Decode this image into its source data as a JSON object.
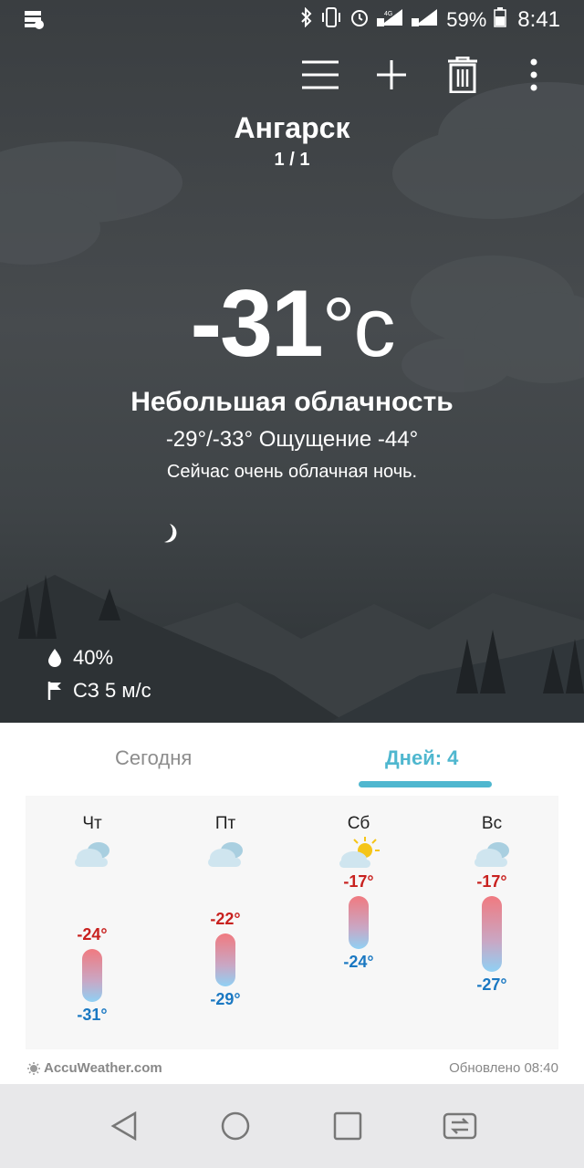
{
  "status_bar": {
    "battery_percent": "59%",
    "time": "8:41",
    "icons": [
      "notification-server-icon",
      "bluetooth-icon",
      "vibrate-icon",
      "alarm-icon",
      "signal-sim1-4g-icon",
      "signal-sim2-icon",
      "battery-icon"
    ],
    "sim1_label": "4G"
  },
  "toolbar": {
    "icons": [
      "menu-icon",
      "add-icon",
      "delete-icon",
      "more-icon"
    ]
  },
  "location": {
    "city": "Ангарск",
    "page_indicator": "1 / 1"
  },
  "current": {
    "temperature": "-31",
    "unit": "°c",
    "condition": "Небольшая облачность",
    "range_feels": "-29°/-33° Ощущение -44°",
    "description": "Сейчас очень облачная ночь.",
    "humidity": "40%",
    "wind": "СЗ 5 м/с"
  },
  "tabs": {
    "today": "Сегодня",
    "days": "Дней: 4",
    "active": "days"
  },
  "forecast": [
    {
      "day": "Чт",
      "icon": "cloudy-icon",
      "high": "-24°",
      "low": "-31°",
      "high_value": -24,
      "low_value": -31
    },
    {
      "day": "Пт",
      "icon": "cloudy-icon",
      "high": "-22°",
      "low": "-29°",
      "high_value": -22,
      "low_value": -29
    },
    {
      "day": "Сб",
      "icon": "partly-sunny-icon",
      "high": "-17°",
      "low": "-24°",
      "high_value": -17,
      "low_value": -24
    },
    {
      "day": "Вс",
      "icon": "cloudy-icon",
      "high": "-17°",
      "low": "-27°",
      "high_value": -17,
      "low_value": -27
    }
  ],
  "footer": {
    "brand": "AccuWeather.com",
    "updated": "Обновлено 08:40"
  },
  "colors": {
    "accent": "#4fb7cf",
    "high_temp": "#c8211f",
    "low_temp": "#1a78c2"
  },
  "nav_bar": {
    "icons": [
      "back-icon",
      "home-icon",
      "recents-icon",
      "dual-window-icon"
    ]
  }
}
